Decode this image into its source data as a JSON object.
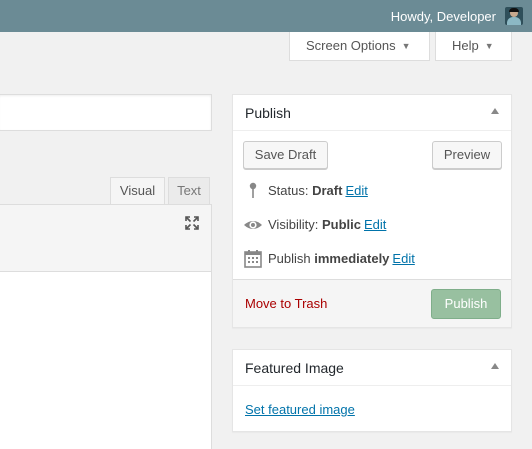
{
  "adminbar": {
    "greeting": "Howdy, Developer",
    "bg_color": "#6b8b95"
  },
  "screen_meta": {
    "screen_options_label": "Screen Options",
    "help_label": "Help",
    "arrow_icon": "triangle-down-icon"
  },
  "editor": {
    "tabs": [
      {
        "label": "Visual",
        "active": true
      },
      {
        "label": "Text",
        "active": false
      }
    ],
    "fullscreen_icon": "expand-icon"
  },
  "publish_box": {
    "title": "Publish",
    "save_draft_label": "Save Draft",
    "preview_label": "Preview",
    "status_label": "Status:",
    "status_value": "Draft",
    "visibility_label": "Visibility:",
    "visibility_value": "Public",
    "publish_label": "Publish",
    "publish_value": "immediately",
    "edit_label": "Edit",
    "move_to_trash_label": "Move to Trash",
    "publish_button_label": "Publish",
    "publish_button_color": "#98c0a0",
    "trash_color": "#aa0000"
  },
  "featured_image_box": {
    "title": "Featured Image",
    "link_label": "Set featured image"
  },
  "colors": {
    "link": "#0073aa",
    "background": "#f1f1f1"
  }
}
